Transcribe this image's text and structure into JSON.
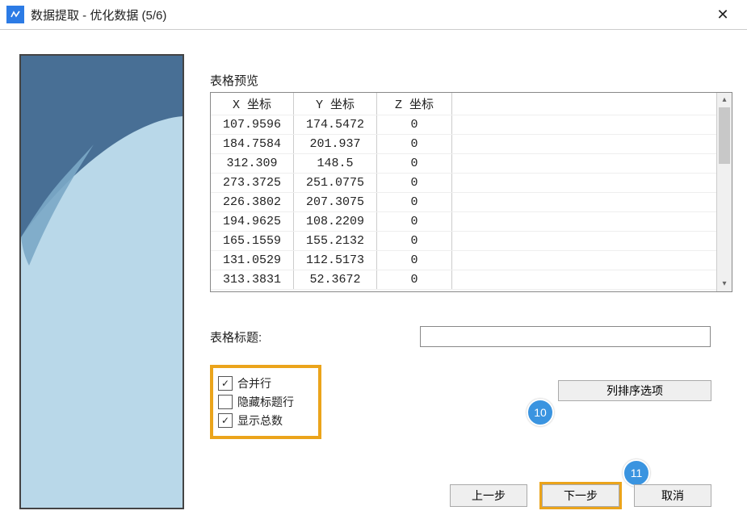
{
  "window": {
    "title": "数据提取 - 优化数据 (5/6)"
  },
  "tablePreviewLabel": "表格预览",
  "table": {
    "headers": [
      "X 坐标",
      "Y 坐标",
      "Z 坐标"
    ],
    "rows": [
      [
        "107.9596",
        "174.5472",
        "0"
      ],
      [
        "184.7584",
        "201.937",
        "0"
      ],
      [
        "312.309",
        "148.5",
        "0"
      ],
      [
        "273.3725",
        "251.0775",
        "0"
      ],
      [
        "226.3802",
        "207.3075",
        "0"
      ],
      [
        "194.9625",
        "108.2209",
        "0"
      ],
      [
        "165.1559",
        "155.2132",
        "0"
      ],
      [
        "131.0529",
        "112.5173",
        "0"
      ],
      [
        "313.3831",
        "52.3672",
        "0"
      ]
    ]
  },
  "tableTitleLabel": "表格标题:",
  "tableTitleValue": "",
  "checkboxes": {
    "mergeRows": {
      "label": "合并行",
      "checked": true
    },
    "hideHeader": {
      "label": "隐藏标题行",
      "checked": false
    },
    "showTotals": {
      "label": "显示总数",
      "checked": true
    }
  },
  "buttons": {
    "colSort": "列排序选项",
    "prev": "上一步",
    "next": "下一步",
    "cancel": "取消"
  },
  "badges": {
    "ten": "10",
    "eleven": "11"
  }
}
